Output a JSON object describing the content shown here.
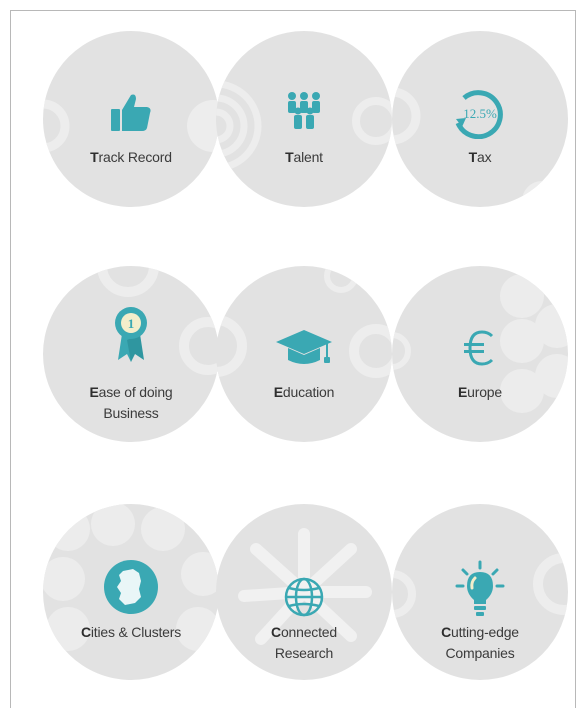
{
  "items": [
    {
      "name": "track-record",
      "first": "T",
      "rest": "rack Record",
      "line2": "",
      "icon": "thumbs-up-icon"
    },
    {
      "name": "talent",
      "first": "T",
      "rest": "alent",
      "line2": "",
      "icon": "people-icon"
    },
    {
      "name": "tax",
      "first": "T",
      "rest": "ax",
      "line2": "",
      "icon": "tax-rate-icon",
      "badge": "12.5%"
    },
    {
      "name": "ease-of-doing-business",
      "first": "E",
      "rest": "ase of doing",
      "line2": "Business",
      "icon": "award-ribbon-icon",
      "badge": "1"
    },
    {
      "name": "education",
      "first": "E",
      "rest": "ducation",
      "line2": "",
      "icon": "graduation-cap-icon"
    },
    {
      "name": "europe",
      "first": "E",
      "rest": "urope",
      "line2": "",
      "icon": "euro-icon"
    },
    {
      "name": "cities-clusters",
      "first": "C",
      "rest": "ities & Clusters",
      "line2": "",
      "icon": "ireland-map-icon"
    },
    {
      "name": "connected-research",
      "first": "C",
      "rest": "onnected",
      "line2": "Research",
      "icon": "globe-icon"
    },
    {
      "name": "cutting-edge-companies",
      "first": "C",
      "rest": "utting-edge",
      "line2": "Companies",
      "icon": "lightbulb-icon"
    }
  ],
  "colors": {
    "accent": "#3aa8b3",
    "circle": "#e2e2e2",
    "pattern": "#ececec",
    "text": "#3b3b3b"
  }
}
